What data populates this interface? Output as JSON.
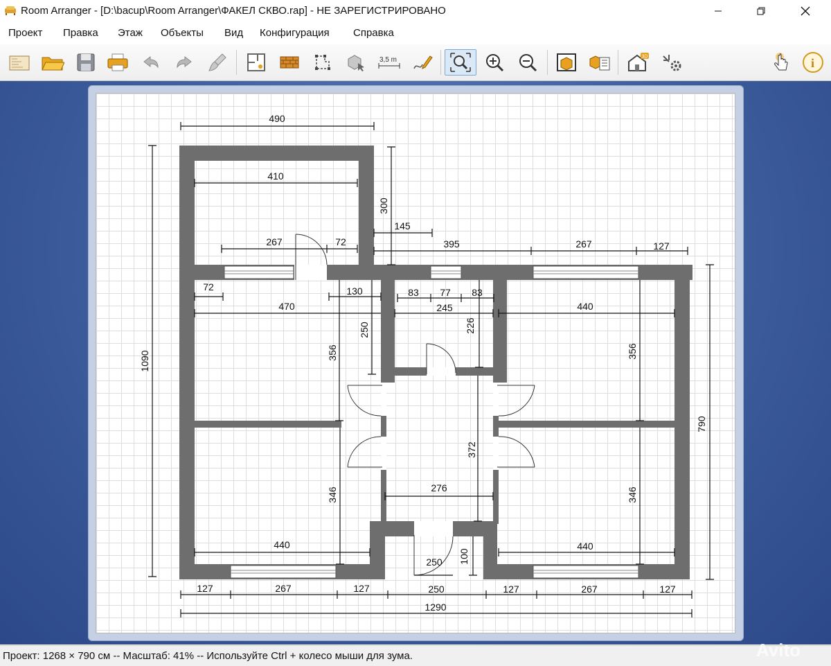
{
  "window": {
    "title": "Room Arranger - [D:\\bacup\\Room Arranger\\ФАКЕЛ СКВО.rap] - НЕ ЗАРЕГИСТРИРОВАНО",
    "controls": [
      "minimize-icon",
      "maximize-icon",
      "close-icon"
    ]
  },
  "menu": {
    "items": [
      {
        "label": "Проект"
      },
      {
        "label": "Правка"
      },
      {
        "label": "Этаж"
      },
      {
        "label": "Объекты"
      },
      {
        "label": "Вид"
      },
      {
        "label": "Конфигурация"
      },
      {
        "label": "Справка"
      }
    ]
  },
  "toolbar": {
    "buttons": [
      {
        "icon": "new-project-icon"
      },
      {
        "icon": "open-folder-icon"
      },
      {
        "icon": "save-icon"
      },
      {
        "icon": "print-icon"
      },
      {
        "icon": "undo-icon"
      },
      {
        "icon": "redo-icon"
      },
      {
        "icon": "paint-brush-icon"
      },
      {
        "icon": "floor-plan-icon"
      },
      {
        "icon": "wall-icon"
      },
      {
        "icon": "polygon-icon"
      },
      {
        "icon": "object-icon"
      },
      {
        "icon": "measure-icon",
        "label": "3,5 m"
      },
      {
        "icon": "draw-icon"
      },
      {
        "icon": "zoom-fit-icon",
        "active": true
      },
      {
        "icon": "zoom-in-icon"
      },
      {
        "icon": "zoom-out-icon"
      },
      {
        "icon": "box-icon"
      },
      {
        "icon": "object-list-icon"
      },
      {
        "icon": "3d-view-icon",
        "label": "3D"
      },
      {
        "icon": "settings-icon"
      },
      {
        "icon": "hand-icon"
      },
      {
        "icon": "info-icon"
      }
    ]
  },
  "plan": {
    "dimensions": [
      "490",
      "1090",
      "410",
      "300",
      "145",
      "267",
      "72",
      "395",
      "267",
      "127",
      "72",
      "130",
      "83",
      "77",
      "83",
      "470",
      "245",
      "440",
      "226",
      "250",
      "356",
      "356",
      "790",
      "372",
      "346",
      "346",
      "276",
      "440",
      "440",
      "100",
      "250",
      "127",
      "267",
      "127",
      "250",
      "127",
      "267",
      "127",
      "1290"
    ],
    "colors": {
      "wall": "#6e6e6e",
      "grid": "#dedede",
      "window": "#cfe3f5"
    }
  },
  "status": {
    "text": "Проект: 1268 × 790 см -- Масштаб: 41% -- Используйте Ctrl + колесо мыши для зума."
  },
  "watermark": {
    "text": "Avito"
  }
}
